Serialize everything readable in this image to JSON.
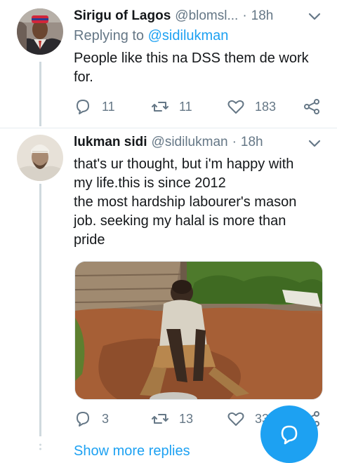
{
  "tweets": [
    {
      "author_name": "Sirigu of Lagos",
      "author_handle": "@blomsl...",
      "time": "18h",
      "replying_prefix": "Replying to",
      "replying_mention": "@sidilukman",
      "text_lines": [
        "People like this na DSS them de work",
        "for."
      ],
      "replies": "11",
      "retweets": "11",
      "likes": "183"
    },
    {
      "author_name": "lukman sidi",
      "author_handle": "@sidilukman",
      "time": "18h",
      "text_lines": [
        "that's ur thought, but i'm happy with",
        "my life.this is since 2012",
        "the most hardship labourer's mason",
        "job. seeking my halal is more than",
        "pride"
      ],
      "replies": "3",
      "retweets": "13",
      "likes": "33"
    }
  ],
  "show_more": "Show more replies",
  "colors": {
    "accent": "#1da1f2",
    "secondary_text": "#657786",
    "primary_text": "#14171a",
    "thread_line": "#cfd9de"
  },
  "icons": [
    "reply-icon",
    "retweet-icon",
    "like-icon",
    "share-icon",
    "chevron-down-icon",
    "compose-reply-icon"
  ]
}
